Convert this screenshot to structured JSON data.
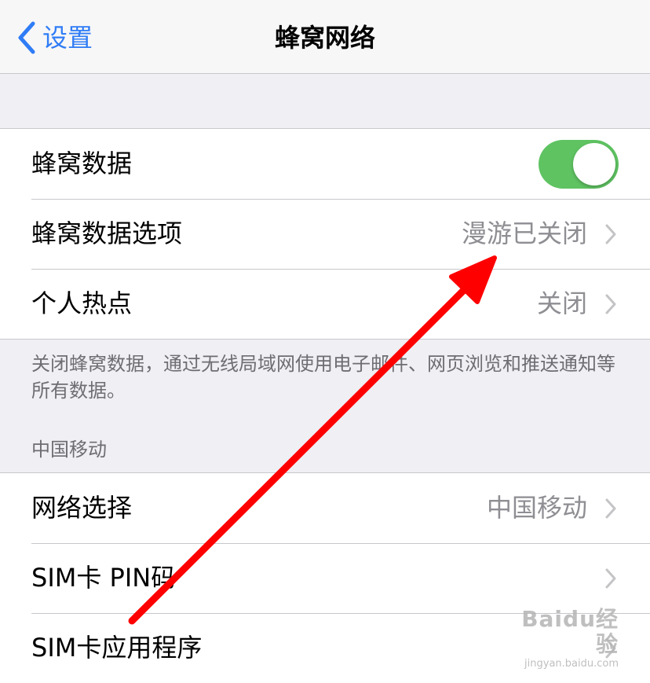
{
  "nav": {
    "back_label": "设置",
    "title": "蜂窝网络"
  },
  "group_main": {
    "rows": [
      {
        "label": "蜂窝数据",
        "value": "",
        "toggle_on": true
      },
      {
        "label": "蜂窝数据选项",
        "value": "漫游已关闭"
      },
      {
        "label": "个人热点",
        "value": "关闭"
      }
    ]
  },
  "footer_note": "关闭蜂窝数据，通过无线局域网使用电子邮件、网页浏览和推送通知等所有数据。",
  "carrier_section": {
    "header": "中国移动",
    "rows": [
      {
        "label": "网络选择",
        "value": "中国移动"
      },
      {
        "label": "SIM卡 PIN码",
        "value": ""
      },
      {
        "label": "SIM卡应用程序",
        "value": ""
      }
    ]
  },
  "watermark": {
    "brand": "Baidu经验",
    "url": "jingyan.baidu.com"
  },
  "colors": {
    "accent": "#2f7cf6",
    "toggle_on": "#5fc362",
    "annotation_arrow": "#ff0000"
  }
}
